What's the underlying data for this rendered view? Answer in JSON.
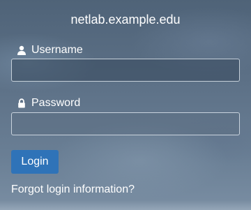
{
  "header": {
    "title": "netlab.example.edu"
  },
  "form": {
    "username": {
      "label": "Username",
      "icon": "user-icon",
      "value": "",
      "placeholder": ""
    },
    "password": {
      "label": "Password",
      "icon": "lock-icon",
      "value": "",
      "placeholder": ""
    },
    "login_label": "Login",
    "forgot_label": "Forgot login information?"
  },
  "colors": {
    "button": "#2f73b8",
    "text": "#ffffff"
  }
}
